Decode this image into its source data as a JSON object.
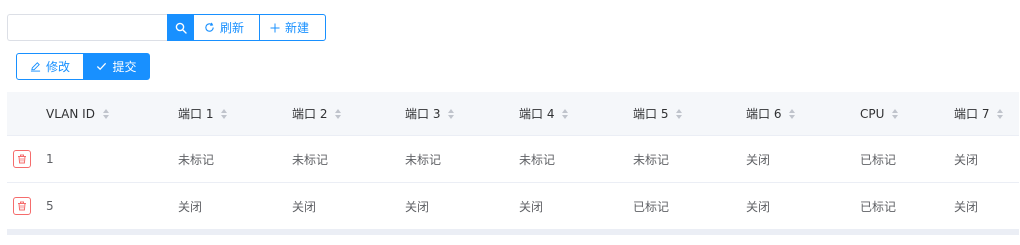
{
  "toolbar": {
    "search_value": "",
    "search_placeholder": "",
    "refresh_label": "刷新",
    "new_label": "新建",
    "edit_label": "修改",
    "submit_label": "提交"
  },
  "colors": {
    "primary": "#1890ff",
    "danger": "#f56c6c"
  },
  "table": {
    "headers": [
      "VLAN ID",
      "端口 1",
      "端口 2",
      "端口 3",
      "端口 4",
      "端口 5",
      "端口 6",
      "CPU",
      "端口 7"
    ],
    "rows": [
      [
        "1",
        "未标记",
        "未标记",
        "未标记",
        "未标记",
        "未标记",
        "关闭",
        "已标记",
        "关闭"
      ],
      [
        "5",
        "关闭",
        "关闭",
        "关闭",
        "关闭",
        "已标记",
        "关闭",
        "已标记",
        "关闭"
      ]
    ]
  }
}
